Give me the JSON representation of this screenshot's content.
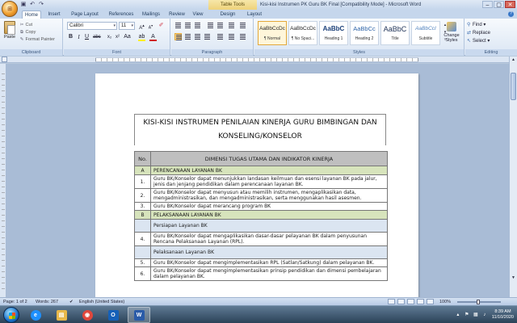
{
  "window": {
    "title": "Kisi-kisi Instrumen PK Guru BK Final [Compatibility Mode] - Microsoft Word",
    "contextual_tab": "Table Tools",
    "controls": [
      "–",
      "▢",
      "✕"
    ]
  },
  "tabs": [
    "Home",
    "Insert",
    "Page Layout",
    "References",
    "Mailings",
    "Review",
    "View",
    "Design",
    "Layout"
  ],
  "active_tab": "Home",
  "ribbon": {
    "clipboard": {
      "label": "Clipboard",
      "paste": "Paste",
      "cut": "Cut",
      "copy": "Copy",
      "format_painter": "Format Painter"
    },
    "font": {
      "label": "Font",
      "family": "Calibri",
      "size": "11",
      "bold": "B",
      "italic": "I",
      "underline": "U"
    },
    "paragraph": {
      "label": "Paragraph"
    },
    "styles": {
      "label": "Styles",
      "items": [
        {
          "sample": "AaBbCcDc",
          "name": "¶ Normal",
          "kind": "normal"
        },
        {
          "sample": "AaBbCcDc",
          "name": "¶ No Spaci...",
          "kind": "normal"
        },
        {
          "sample": "AaBbC",
          "name": "Heading 1",
          "kind": "h1"
        },
        {
          "sample": "AaBbCc",
          "name": "Heading 2",
          "kind": "h2"
        },
        {
          "sample": "AaBbC",
          "name": "Title",
          "kind": "title"
        },
        {
          "sample": "AaBbCcI",
          "name": "Subtitle",
          "kind": "sub"
        }
      ],
      "change_styles": "Change Styles"
    },
    "editing": {
      "label": "Editing",
      "find": "Find",
      "replace": "Replace",
      "select": "Select"
    }
  },
  "document": {
    "title": "KISI-KISI INSTRUMEN PENILAIAN KINERJA GURU BIMBINGAN DAN KONSELING/KONSELOR",
    "table": {
      "headers": [
        "No.",
        "DIMENSI TUGAS UTAMA DAN INDIKATOR KINERJA"
      ],
      "rows": [
        {
          "type": "section",
          "no": "A",
          "text": "PERENCANAAN LAYANAN BK"
        },
        {
          "type": "item",
          "no": "1.",
          "text": "Guru BK/Konselor dapat menunjukkan landasan keilmuan dan esensi layanan BK pada jalur, jenis dan jenjang pendidikan dalam perencanaan layanan BK."
        },
        {
          "type": "item",
          "no": "2.",
          "text": "Guru BK/Konselor dapat menyusun atau memilih instrumen, mengaplikasikan data, mengadministrasikan, dan mengadministrasikan, serta menggunakan hasil asesmen."
        },
        {
          "type": "item",
          "no": "3.",
          "text": "Guru BK/Konselor dapat merancang program BK"
        },
        {
          "type": "section",
          "no": "B",
          "text": "PELAKSANAAN LAYANAN BK"
        },
        {
          "type": "subsection",
          "no": "",
          "text": "Persiapan Layanan BK"
        },
        {
          "type": "item",
          "no": "4.",
          "text": "Guru BK/Konselor dapat mengaplikasikan dasar-dasar pelayanan BK dalam penyusunan Rencana Pelaksanaan Layanan (RPL)."
        },
        {
          "type": "subsection",
          "no": "",
          "text": "Pelaksanaan Layanan BK"
        },
        {
          "type": "item",
          "no": "5.",
          "text": "Guru BK/Konselor dapat mengimplementasikan RPL (Satlan/Satkung) dalam pelayanan BK."
        },
        {
          "type": "item",
          "no": "6.",
          "text": "Guru BK/Konselor dapat mengimplementasikan prinsip pendidikan dan dimensi pembelajaran dalam pelayanan BK."
        }
      ]
    }
  },
  "status": {
    "page": "Page: 1 of 2",
    "words": "Words: 267",
    "language": "English (United States)",
    "zoom": "100%"
  },
  "taskbar": {
    "apps": [
      {
        "name": "ie",
        "glyph": "e",
        "color": "#1e90ff"
      },
      {
        "name": "explorer",
        "glyph": "▤",
        "color": "#e8b84a"
      },
      {
        "name": "chrome",
        "glyph": "◉",
        "color": "#e0473c"
      },
      {
        "name": "outlook",
        "glyph": "O",
        "color": "#1560b8"
      },
      {
        "name": "word",
        "glyph": "W",
        "color": "#2a5ba8"
      }
    ],
    "time": "8:39 AM",
    "date": "11/10/2020"
  }
}
